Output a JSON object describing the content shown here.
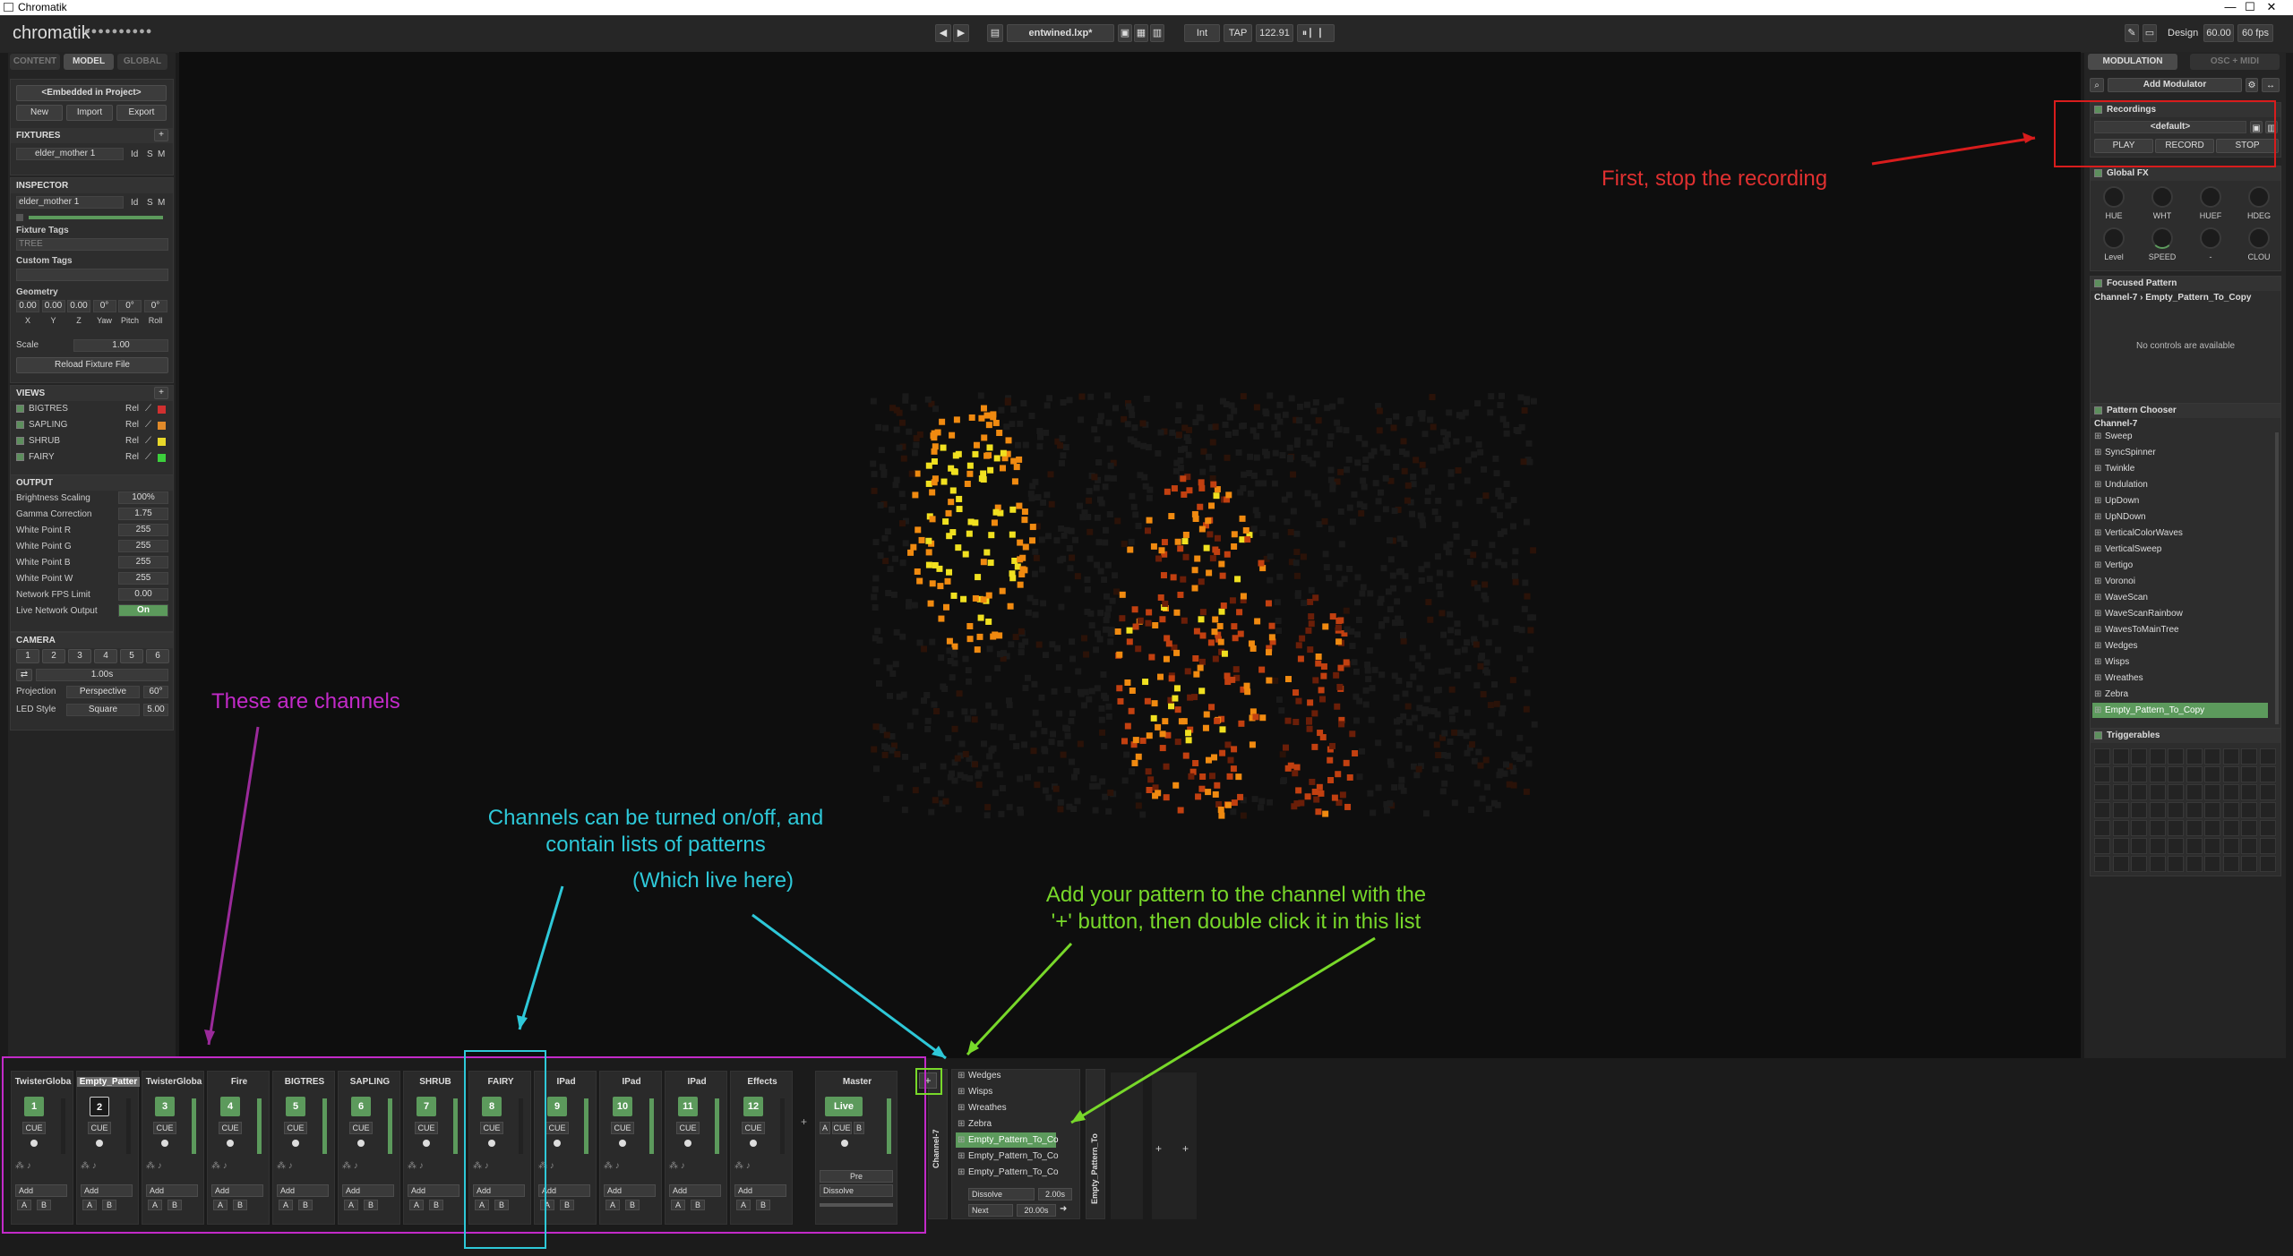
{
  "window": {
    "title": "Chromatik",
    "min": "—",
    "max": "☐",
    "close": "✕"
  },
  "topbar": {
    "logo": "chromatik",
    "logo_dots": "●●●●●●●●●●",
    "prev": "◀",
    "next": "▶",
    "file": "entwined.lxp*",
    "int": "Int",
    "tap": "TAP",
    "bpm": "122.91",
    "design": "Design",
    "design_val": "60.00",
    "fps": "60 fps"
  },
  "left": {
    "tabs": [
      "CONTENT",
      "MODEL",
      "GLOBAL"
    ],
    "embedded": "<Embedded in Project>",
    "new": "New",
    "import": "Import",
    "export": "Export",
    "fixtures_h": "FIXTURES",
    "fixture_name": "elder_mother 1",
    "fixture_id": "Id",
    "fixture_s": "S",
    "fixture_m": "M",
    "inspector_h": "INSPECTOR",
    "insp_name": "elder_mother 1",
    "insp_id": "Id",
    "insp_s": "S",
    "insp_m": "M",
    "fixture_tags": "Fixture Tags",
    "tree_tag": "TREE",
    "custom_tags": "Custom Tags",
    "geometry": "Geometry",
    "geo_vals": [
      "0.00",
      "0.00",
      "0.00",
      "0°",
      "0°",
      "0°"
    ],
    "geo_labels": [
      "X",
      "Y",
      "Z",
      "Yaw",
      "Pitch",
      "Roll"
    ],
    "scale": "Scale",
    "scale_val": "1.00",
    "reload": "Reload Fixture File",
    "views_h": "VIEWS",
    "views": [
      {
        "name": "BIGTRES",
        "rel": "Rel",
        "color": "#d03030"
      },
      {
        "name": "SAPLING",
        "rel": "Rel",
        "color": "#e08a2a"
      },
      {
        "name": "SHRUB",
        "rel": "Rel",
        "color": "#e8d82a"
      },
      {
        "name": "FAIRY",
        "rel": "Rel",
        "color": "#3ccf3c"
      }
    ],
    "output_h": "OUTPUT",
    "output": [
      {
        "label": "Brightness Scaling",
        "val": "100%"
      },
      {
        "label": "Gamma Correction",
        "val": "1.75"
      },
      {
        "label": "White Point R",
        "val": "255"
      },
      {
        "label": "White Point G",
        "val": "255"
      },
      {
        "label": "White Point B",
        "val": "255"
      },
      {
        "label": "White Point W",
        "val": "255"
      },
      {
        "label": "Network FPS Limit",
        "val": "0.00"
      },
      {
        "label": "Live Network Output",
        "val": "On"
      }
    ],
    "camera_h": "CAMERA",
    "cam_btns": [
      "1",
      "2",
      "3",
      "4",
      "5",
      "6"
    ],
    "cam_time": "1.00s",
    "projection": "Projection",
    "proj_val": "Perspective",
    "proj_deg": "60°",
    "led_style": "LED Style",
    "led_val": "Square",
    "led_size": "5.00"
  },
  "right": {
    "tabs": [
      "MODULATION",
      "OSC + MIDI"
    ],
    "add_mod": "Add Modulator",
    "recordings": "Recordings",
    "rec_default": "<default>",
    "play": "PLAY",
    "record": "RECORD",
    "stop": "STOP",
    "global_fx": "Global FX",
    "knobs": [
      "HUE",
      "WHT",
      "HUEF",
      "HDEG",
      "Level",
      "SPEED",
      "-",
      "CLOU"
    ],
    "focused": "Focused Pattern",
    "focused_name": "Channel-7 › Empty_Pattern_To_Copy",
    "no_controls": "No controls are available",
    "chooser": "Pattern Chooser",
    "chooser_ch": "Channel-7",
    "patterns": [
      "Sweep",
      "SyncSpinner",
      "Twinkle",
      "Undulation",
      "UpDown",
      "UpNDown",
      "VerticalColorWaves",
      "VerticalSweep",
      "Vertigo",
      "Voronoi",
      "WaveScan",
      "WaveScanRainbow",
      "WavesToMainTree",
      "Wedges",
      "Wisps",
      "Wreathes",
      "Zebra",
      "Empty_Pattern_To_Copy"
    ],
    "triggerables": "Triggerables"
  },
  "mixer": {
    "channels": [
      {
        "name": "TwisterGloba",
        "num": "1",
        "cue": "CUE",
        "add": "Add",
        "a": "A",
        "b": "B"
      },
      {
        "name": "Empty_Patter",
        "num": "2",
        "cue": "CUE",
        "add": "Add",
        "a": "A",
        "b": "B"
      },
      {
        "name": "TwisterGloba",
        "num": "3",
        "cue": "CUE",
        "add": "Add",
        "a": "A",
        "b": "B"
      },
      {
        "name": "Fire",
        "num": "4",
        "cue": "CUE",
        "add": "Add",
        "a": "A",
        "b": "B"
      },
      {
        "name": "BIGTRES",
        "num": "5",
        "cue": "CUE",
        "add": "Add",
        "a": "A",
        "b": "B"
      },
      {
        "name": "SAPLING",
        "num": "6",
        "cue": "CUE",
        "add": "Add",
        "a": "A",
        "b": "B"
      },
      {
        "name": "SHRUB",
        "num": "7",
        "cue": "CUE",
        "add": "Add",
        "a": "A",
        "b": "B"
      },
      {
        "name": "FAIRY",
        "num": "8",
        "cue": "CUE",
        "add": "Add",
        "a": "A",
        "b": "B"
      },
      {
        "name": "IPad",
        "num": "9",
        "cue": "CUE",
        "add": "Add",
        "a": "A",
        "b": "B"
      },
      {
        "name": "IPad",
        "num": "10",
        "cue": "CUE",
        "add": "Add",
        "a": "A",
        "b": "B"
      },
      {
        "name": "IPad",
        "num": "11",
        "cue": "CUE",
        "add": "Add",
        "a": "A",
        "b": "B"
      },
      {
        "name": "Effects",
        "num": "12",
        "cue": "CUE",
        "add": "Add",
        "a": "A",
        "b": "B"
      }
    ],
    "master": "Master",
    "live": "Live",
    "m_a": "A",
    "m_cue": "CUE",
    "m_b": "B",
    "pre": "Pre",
    "dissolve": "Dissolve",
    "plus": "+",
    "ch7": "Channel-7",
    "ch7_items": [
      "Wedges",
      "Wisps",
      "Wreathes",
      "Zebra",
      "Empty_Pattern_To_Co",
      "Empty_Pattern_To_Co",
      "Empty_Pattern_To_Co"
    ],
    "ch7_dissolve": "Dissolve",
    "ch7_dur": "2.00s",
    "ch7_next": "Next",
    "ch7_next_dur": "20.00s",
    "side_label": "Empty_Pattern_To"
  },
  "annotations": {
    "stop": "First, stop the recording",
    "channels": "These are channels",
    "onoff1": "Channels can be turned on/off, and",
    "onoff2": "contain lists of patterns",
    "livehere": "(Which live here)",
    "add1": "Add your pattern to the channel with the",
    "add2": "'+' button, then double click it in this list"
  }
}
